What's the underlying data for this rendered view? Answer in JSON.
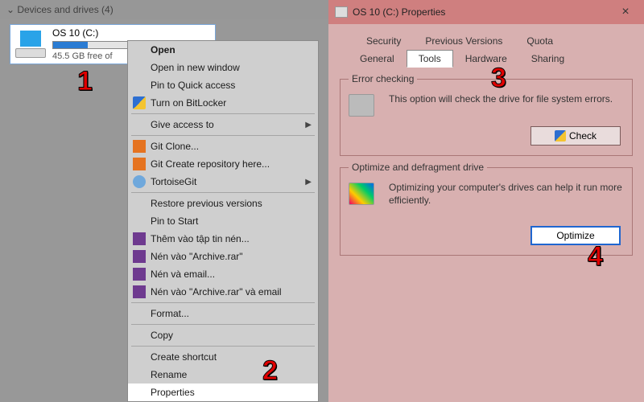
{
  "left": {
    "section_header": "Devices and drives (4)",
    "drive": {
      "name": "OS 10 (C:)",
      "free_text": "45.5 GB free of"
    }
  },
  "context_menu": {
    "items": [
      {
        "label": "Open",
        "bold": true
      },
      {
        "label": "Open in new window"
      },
      {
        "label": "Pin to Quick access"
      },
      {
        "label": "Turn on BitLocker",
        "icon": "shield"
      },
      {
        "sep": true
      },
      {
        "label": "Give access to",
        "submenu": true
      },
      {
        "sep": true
      },
      {
        "label": "Git Clone...",
        "icon": "git"
      },
      {
        "label": "Git Create repository here...",
        "icon": "git"
      },
      {
        "label": "TortoiseGit",
        "icon": "tort",
        "submenu": true
      },
      {
        "sep": true
      },
      {
        "label": "Restore previous versions"
      },
      {
        "label": "Pin to Start"
      },
      {
        "label": "Thêm vào tập tin nén...",
        "icon": "rar"
      },
      {
        "label": "Nén vào \"Archive.rar\"",
        "icon": "rar"
      },
      {
        "label": "Nén và email...",
        "icon": "rar"
      },
      {
        "label": "Nén vào \"Archive.rar\" và email",
        "icon": "rar"
      },
      {
        "sep": true
      },
      {
        "label": "Format..."
      },
      {
        "sep": true
      },
      {
        "label": "Copy"
      },
      {
        "sep": true
      },
      {
        "label": "Create shortcut"
      },
      {
        "label": "Rename"
      },
      {
        "label": "Properties",
        "highlight": true
      }
    ]
  },
  "dialog": {
    "title": "OS 10 (C:) Properties",
    "tabs_row1": [
      "Security",
      "Previous Versions",
      "Quota"
    ],
    "tabs_row2": [
      "General",
      "Tools",
      "Hardware",
      "Sharing"
    ],
    "active_tab": "Tools",
    "error_group": {
      "title": "Error checking",
      "desc": "This option will check the drive for file system errors.",
      "button": "Check"
    },
    "optimize_group": {
      "title": "Optimize and defragment drive",
      "desc": "Optimizing your computer's drives can help it run more efficiently.",
      "button": "Optimize"
    }
  },
  "callouts": {
    "n1": "1",
    "n2": "2",
    "n3": "3",
    "n4": "4"
  }
}
